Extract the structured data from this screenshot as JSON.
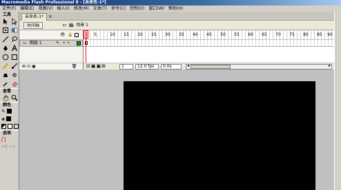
{
  "window": {
    "title": "Macromedia Flash Professional 8 - [未命名-1*]"
  },
  "menu": [
    "文件(F)",
    "编辑(E)",
    "视图(V)",
    "插入(I)",
    "修改(M)",
    "文本(T)",
    "命令(C)",
    "控制(O)",
    "窗口(W)",
    "帮助(H)"
  ],
  "tools": {
    "header": "工具",
    "view_label": "查看",
    "color_label": "颜色",
    "options_label": "选项",
    "snap_glyphs": "+5 +<"
  },
  "document": {
    "tab": "未命名-1*",
    "close": "×"
  },
  "timeline": {
    "button": "时间轴",
    "scene": "场景 1",
    "layer_name": "图层 1",
    "ruler": [
      "1",
      "5",
      "10",
      "15",
      "20",
      "25",
      "30",
      "35",
      "40",
      "45",
      "50",
      "55",
      "60",
      "65",
      "70",
      "75",
      "80",
      "85",
      "90"
    ],
    "current_frame": "1",
    "frame_rate": "12.0 fps",
    "elapsed": "0.0s"
  },
  "colors": {
    "stage": "#000000",
    "pasteboard": "#c0c0c0",
    "playhead": "#ff0000"
  }
}
